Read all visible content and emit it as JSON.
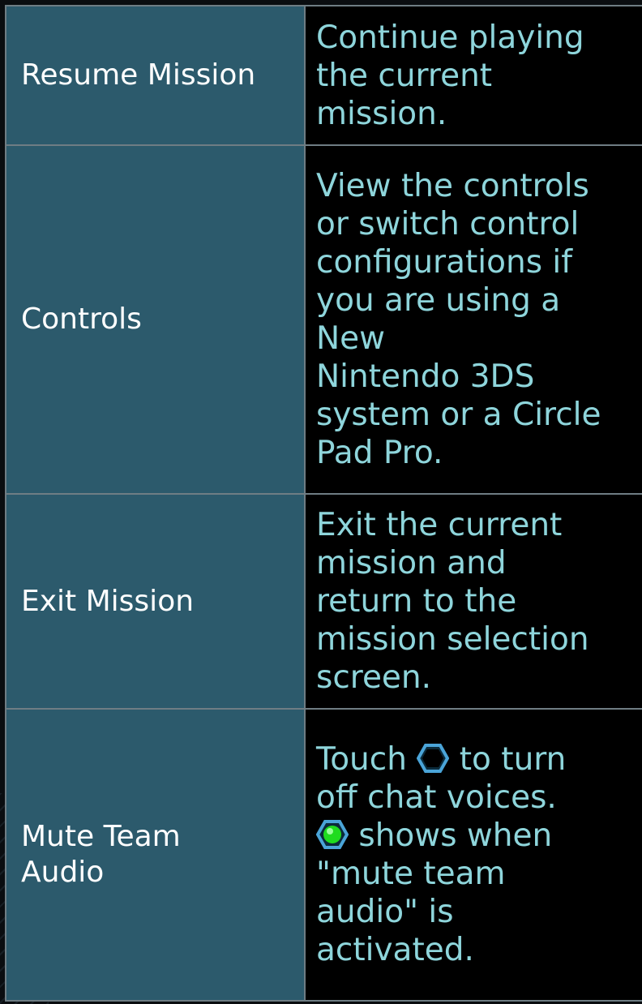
{
  "rows": [
    {
      "name": "Resume Mission",
      "desc_lines": [
        "Continue playing",
        "the current",
        "mission."
      ]
    },
    {
      "name": "Controls",
      "desc_lines": [
        "View the controls",
        "or switch control",
        "configurations if",
        "you are using a",
        "New",
        "Nintendo 3DS",
        "system or a Circle",
        "Pad Pro."
      ]
    },
    {
      "name": "Exit Mission",
      "desc_lines": [
        "Exit the current",
        "mission and",
        "return to the",
        "mission selection",
        "screen."
      ]
    },
    {
      "name_lines": [
        "Mute Team",
        "Audio"
      ],
      "desc": {
        "line1_pre": "Touch ",
        "line1_post": " to turn",
        "line2": "off chat voices.",
        "line3_post": " shows when",
        "line4": "\"mute team",
        "line5": "audio\" is",
        "line6": "activated."
      },
      "icons": {
        "off_icon": "hexagon-outline-icon",
        "on_icon": "hexagon-green-icon"
      }
    }
  ],
  "colors": {
    "name_cell_bg": "#2c5a6c",
    "desc_cell_bg": "#000000",
    "name_text": "#ffffff",
    "desc_text": "#8ed5db",
    "border": "#6f7d84",
    "icon_green": "#1fdc1f",
    "icon_blue": "#4aa4d8"
  }
}
